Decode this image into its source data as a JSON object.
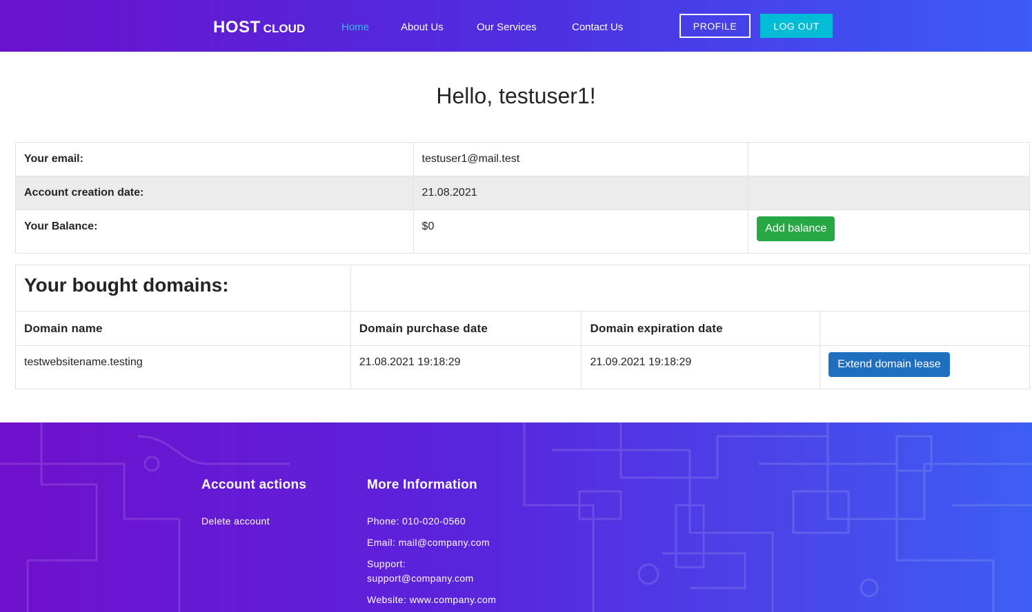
{
  "header": {
    "logo_main": "HOST",
    "logo_sub": "CLOUD",
    "nav": [
      "Home",
      "About Us",
      "Our Services",
      "Contact Us"
    ],
    "profile_label": "PROFILE",
    "logout_label": "LOG OUT"
  },
  "greeting": "Hello, testuser1!",
  "account": {
    "email_label": "Your email:",
    "email_value": "testuser1@mail.test",
    "created_label": "Account creation date:",
    "created_value": "21.08.2021",
    "balance_label": "Your Balance:",
    "balance_value": "$0",
    "add_balance_label": "Add balance"
  },
  "domains": {
    "title": "Your bought domains:",
    "columns": [
      "Domain name",
      "Domain purchase date",
      "Domain expiration date"
    ],
    "rows": [
      {
        "name": "testwebsitename.testing",
        "purchase": "21.08.2021 19:18:29",
        "expiration": "21.09.2021 19:18:29",
        "action": "Extend domain lease"
      }
    ]
  },
  "footer": {
    "account_title": "Account actions",
    "delete_account": "Delete account",
    "info_title": "More Information",
    "phone": "Phone: 010-020-0560",
    "email": "Email: mail@company.com",
    "support_label": "Support:",
    "support_email": "support@company.com",
    "website": "Website: www.company.com"
  },
  "colors": {
    "header_gradient_start": "#6a11cb",
    "header_gradient_end": "#3b5cf5",
    "nav_active": "#35b6ee",
    "logout_bg": "#00bcd4",
    "add_balance_bg": "#28a745",
    "extend_bg": "#1f6fc1"
  }
}
